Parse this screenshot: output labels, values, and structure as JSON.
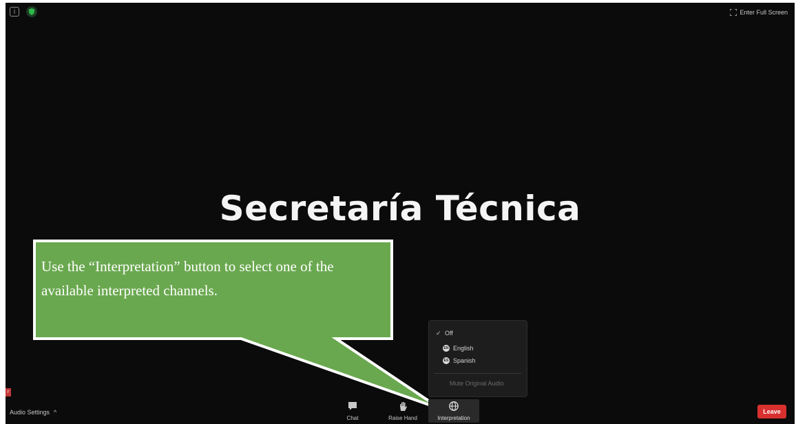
{
  "topbar": {
    "info_glyph": "i",
    "fullscreen_label": "Enter Full Screen",
    "shield_color": "#2db84a"
  },
  "shared_screen": {
    "title": "Secretaría Técnica"
  },
  "callout": {
    "text": "Use the “Interpretation” button to select one of the available interpreted channels.",
    "fill_color": "#6aa84f",
    "border_color": "#ffffff"
  },
  "interpretation_menu": {
    "off_label": "Off",
    "check_glyph": "✓",
    "languages": [
      {
        "badge": "EN",
        "label": "English"
      },
      {
        "badge": "ES",
        "label": "Spanish"
      }
    ],
    "mute_label": "Mute Original Audio"
  },
  "toolbar": {
    "audio_settings_label": "Audio Settings",
    "audio_caret": "^",
    "chat_label": "Chat",
    "raise_hand_label": "Raise Hand",
    "interpretation_label": "Interpretation",
    "leave_label": "Leave",
    "leave_color": "#d8302f",
    "participant_badge": "r"
  }
}
